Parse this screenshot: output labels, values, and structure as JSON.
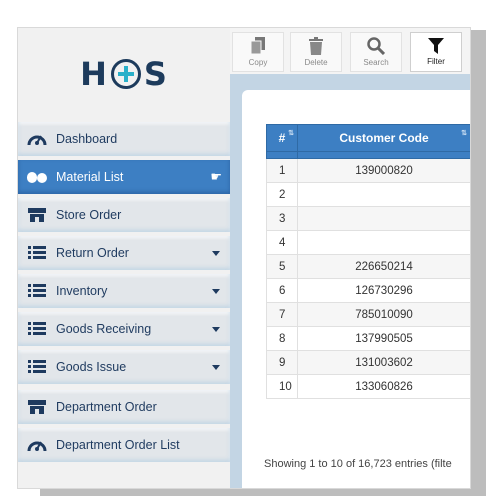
{
  "logo": {
    "left": "H",
    "right": "S"
  },
  "toolbar": {
    "copy": "Copy",
    "delete": "Delete",
    "search": "Search",
    "filter": "Filter"
  },
  "sidebar": {
    "items": [
      {
        "label": "Dashboard",
        "icon": "gauge-icon"
      },
      {
        "label": "Material List",
        "icon": "pills-icon",
        "active": true
      },
      {
        "label": "Store Order",
        "icon": "store-icon"
      },
      {
        "label": "Return Order",
        "icon": "list-icon",
        "caret": true
      },
      {
        "label": "Inventory",
        "icon": "list-icon",
        "caret": true
      },
      {
        "label": "Goods Receiving",
        "icon": "list-icon",
        "caret": true
      },
      {
        "label": "Goods Issue",
        "icon": "list-icon",
        "caret": true
      },
      {
        "label": "Department Order",
        "icon": "store-icon"
      },
      {
        "label": "Department Order List",
        "icon": "gauge-icon"
      }
    ]
  },
  "table": {
    "headers": [
      "#",
      "Customer Code"
    ],
    "rows": [
      {
        "num": "1",
        "code": "139000820"
      },
      {
        "num": "2",
        "code": ""
      },
      {
        "num": "3",
        "code": ""
      },
      {
        "num": "4",
        "code": ""
      },
      {
        "num": "5",
        "code": "226650214"
      },
      {
        "num": "6",
        "code": "126730296"
      },
      {
        "num": "7",
        "code": "785010090"
      },
      {
        "num": "8",
        "code": "137990505"
      },
      {
        "num": "9",
        "code": "131003602"
      },
      {
        "num": "10",
        "code": "133060826"
      }
    ]
  },
  "footer": {
    "text": "Showing 1 to 10 of 16,723 entries (filte"
  },
  "colors": {
    "accent": "#3d7fc3",
    "brand": "#1d3b5c",
    "logo_plus": "#2ab0c9"
  }
}
